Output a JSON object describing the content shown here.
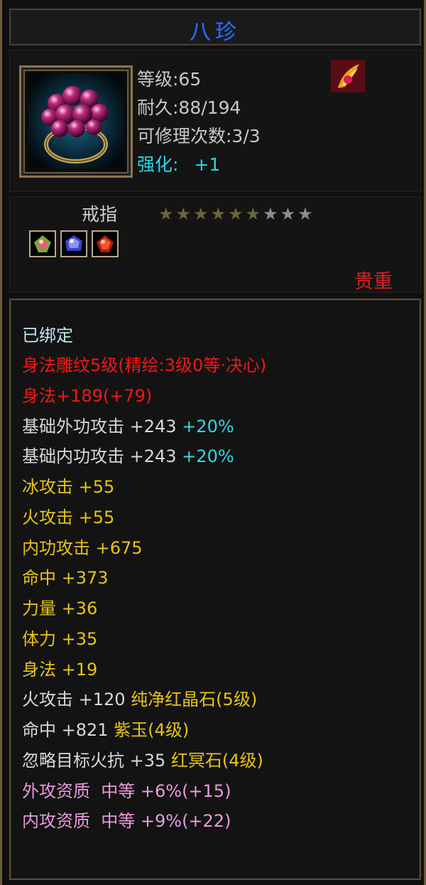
{
  "title": "八珍",
  "info": {
    "level": "等级:65",
    "durability": "耐久:88/194",
    "repair_count": "可修理次数:3/3",
    "enhance_label": "强化:",
    "enhance_value": "+1"
  },
  "item_type": "戒指",
  "stars": {
    "filled": 6,
    "total": 9
  },
  "gem_slots": [
    "green-gem-icon",
    "blue-gem-icon",
    "red-gem-icon"
  ],
  "rarity": "贵重",
  "attributes": {
    "bound": "已绑定",
    "engrave": "身法雕纹5级(精绘:3级0等·决心)",
    "agility_total": "身法+189(+79)",
    "base_ext_attack": "基础外功攻击 +243",
    "base_ext_attack_pct": "+20%",
    "base_int_attack": "基础内功攻击 +243",
    "base_int_attack_pct": "+20%",
    "ice_attack": "冰攻击 +55",
    "fire_attack": "火攻击 +55",
    "internal_attack": "内功攻击 +675",
    "hit": "命中 +373",
    "strength": "力量 +36",
    "stamina": "体力 +35",
    "agility": "身法 +19",
    "gem1_stat": "火攻击 +120",
    "gem1_name": "纯净红晶石(5级)",
    "gem2_stat": "命中 +821",
    "gem2_name": "紫玉(4级)",
    "gem3_stat": "忽略目标火抗 +35",
    "gem3_name": "红冥石(4级)",
    "ext_quality": "外攻资质  中等 +6%(+15)",
    "int_quality": "内攻资质  中等 +9%(+22)"
  },
  "colors": {
    "title": "#2d6fe0",
    "enhance": "#2ad6e6",
    "rarity": "#e02020",
    "red": "#f01818",
    "yellow": "#e6c417",
    "cyan": "#2fd8e8",
    "pink": "#e99adf"
  }
}
